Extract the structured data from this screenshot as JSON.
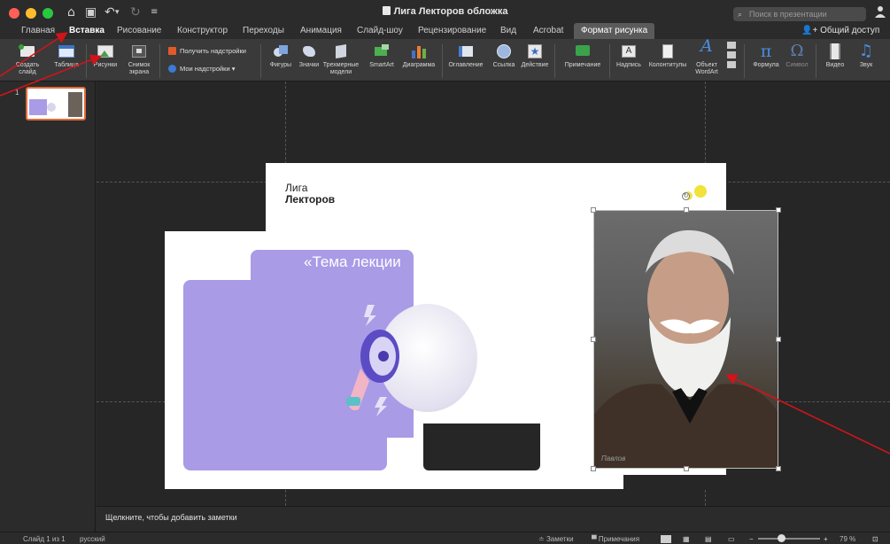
{
  "window": {
    "title": "Лига Лекторов обложка",
    "search_placeholder": "Поиск в презентации"
  },
  "tabs": [
    {
      "label": "Главная"
    },
    {
      "label": "Вставка"
    },
    {
      "label": "Рисование"
    },
    {
      "label": "Конструктор"
    },
    {
      "label": "Переходы"
    },
    {
      "label": "Анимация"
    },
    {
      "label": "Слайд-шоу"
    },
    {
      "label": "Рецензирование"
    },
    {
      "label": "Вид"
    },
    {
      "label": "Acrobat"
    },
    {
      "label": "Формат рисунка"
    }
  ],
  "share_label": "Общий доступ",
  "ribbon": {
    "new_slide": "Создать слайд",
    "table": "Таблица",
    "pictures": "Рисунки",
    "screenshot": "Снимок экрана",
    "get_addins": "Получить надстройки",
    "my_addins": "Мои надстройки",
    "shapes": "Фигуры",
    "icons": "Значки",
    "models_3d": "Трехмерные модели",
    "smartart": "SmartArt",
    "chart": "Диаграмма",
    "toc": "Оглавление",
    "link": "Ссылка",
    "action": "Действие",
    "comment": "Примечание",
    "textbox": "Надпись",
    "header_footer": "Колонтитулы",
    "wordart": "Объект WordArt",
    "equation": "Формула",
    "symbol": "Символ",
    "video": "Видео",
    "audio": "Звук"
  },
  "thumbnail": {
    "number": "1"
  },
  "slide": {
    "brand_line1": "Лига",
    "brand_line2": "Лекторов",
    "topic": "«Тема лекции",
    "photo_caption": "Павлов"
  },
  "notes_placeholder": "Щелкните, чтобы добавить заметки",
  "status": {
    "slide_of": "Слайд 1 из 1",
    "language": "русский",
    "notes": "Заметки",
    "comments": "Примечания",
    "zoom": "79 %"
  },
  "colors": {
    "accent_purple": "#a99be6",
    "annotation_arrow": "#d0141a",
    "selection_thumb_border": "#e06b3a"
  }
}
